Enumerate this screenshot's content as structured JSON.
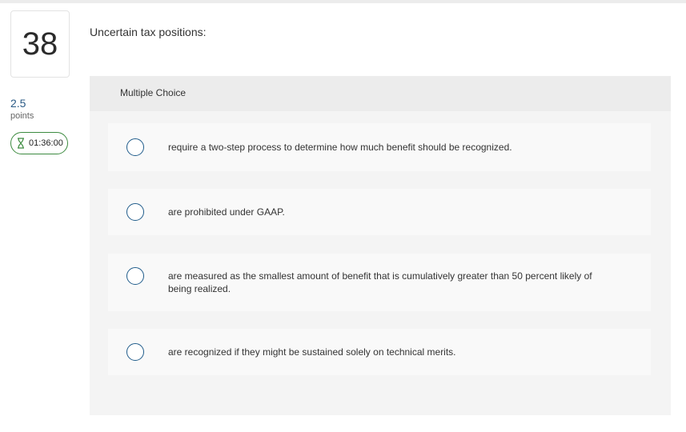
{
  "question": {
    "number": "38",
    "points_value": "2.5",
    "points_label": "points",
    "timer": "01:36:00",
    "text": "Uncertain tax positions:"
  },
  "panel": {
    "header": "Multiple Choice",
    "choices": [
      {
        "label": "require a two-step process to determine how much benefit should be recognized."
      },
      {
        "label": "are prohibited under GAAP."
      },
      {
        "label": "are measured as the smallest amount of benefit that is cumulatively greater than 50 percent likely of being realized."
      },
      {
        "label": "are recognized if they might be sustained solely on technical merits."
      }
    ]
  },
  "colors": {
    "accent_blue": "#1f5b8a",
    "timer_green": "#3d8b40"
  },
  "icons": {
    "timer": "hourglass-icon"
  }
}
